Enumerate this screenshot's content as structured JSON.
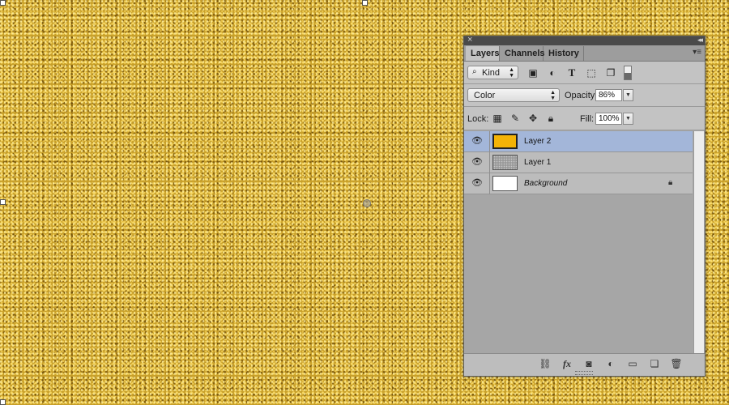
{
  "panel": {
    "tabs": [
      {
        "label": "Layers",
        "active": true
      },
      {
        "label": "Channels",
        "active": false
      },
      {
        "label": "History",
        "active": false
      }
    ],
    "filter": {
      "label": "Kind",
      "icons": [
        "pixel-filter-icon",
        "adjustment-filter-icon",
        "type-filter-icon",
        "shape-filter-icon",
        "smart-object-filter-icon",
        "filter-toggle-icon"
      ]
    },
    "blend_mode": "Color",
    "opacity_label": "Opacity:",
    "opacity_value": "86%",
    "lock_label": "Lock:",
    "lock_icons": [
      "lock-transparent-icon",
      "lock-image-icon",
      "lock-position-icon",
      "lock-all-icon"
    ],
    "fill_label": "Fill:",
    "fill_value": "100%",
    "layers": [
      {
        "name": "Layer 2",
        "selected": true,
        "thumb_color": "#f3b307",
        "visible": true,
        "locked": false
      },
      {
        "name": "Layer 1",
        "selected": false,
        "thumb_color": "#9a9a9a",
        "visible": true,
        "locked": false
      },
      {
        "name": "Background",
        "selected": false,
        "thumb_color": "#ffffff",
        "visible": true,
        "locked": true
      }
    ],
    "bottom_icons": [
      "link-layers-icon",
      "fx-icon",
      "add-mask-icon",
      "adjustment-layer-icon",
      "new-group-icon",
      "new-layer-icon",
      "delete-layer-icon"
    ]
  },
  "colors": {
    "selection": "#a3b6d9",
    "gold": "#c8a02a"
  }
}
